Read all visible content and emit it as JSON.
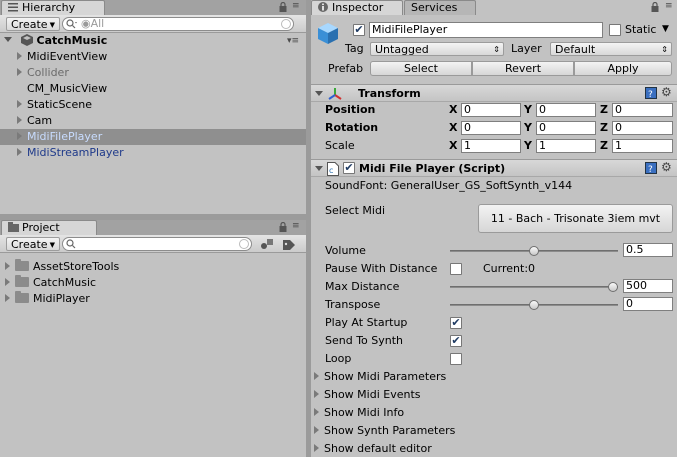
{
  "hierarchy": {
    "tab_label": "Hierarchy",
    "create_label": "Create",
    "search_placeholder": "◉All",
    "scene_name": "CatchMusic",
    "items": [
      {
        "label": "MidiEventView",
        "expandable": true,
        "state": "normal"
      },
      {
        "label": "Collider",
        "expandable": true,
        "state": "disabled"
      },
      {
        "label": "CM_MusicView",
        "expandable": false,
        "state": "normal"
      },
      {
        "label": "StaticScene",
        "expandable": true,
        "state": "normal"
      },
      {
        "label": "Cam",
        "expandable": true,
        "state": "normal"
      },
      {
        "label": "MidiFilePlayer",
        "expandable": true,
        "state": "selected"
      },
      {
        "label": "MidiStreamPlayer",
        "expandable": true,
        "state": "prefab"
      }
    ]
  },
  "project": {
    "tab_label": "Project",
    "create_label": "Create",
    "folders": [
      "AssetStoreTools",
      "CatchMusic",
      "MidiPlayer"
    ]
  },
  "inspector": {
    "tab_label": "Inspector",
    "services_tab_label": "Services",
    "object_name": "MidiFilePlayer",
    "static_label": "Static",
    "tag_label": "Tag",
    "tag_value": "Untagged",
    "layer_label": "Layer",
    "layer_value": "Default",
    "prefab_label": "Prefab",
    "prefab_buttons": [
      "Select",
      "Revert",
      "Apply"
    ],
    "transform": {
      "title": "Transform",
      "rows": [
        {
          "label": "Position",
          "bold": true,
          "x": "0",
          "y": "0",
          "z": "0"
        },
        {
          "label": "Rotation",
          "bold": true,
          "x": "0",
          "y": "0",
          "z": "0"
        },
        {
          "label": "Scale",
          "bold": false,
          "x": "1",
          "y": "1",
          "z": "1"
        }
      ],
      "axis_labels": [
        "X",
        "Y",
        "Z"
      ]
    },
    "script": {
      "title": "Midi File Player (Script)",
      "soundfont_text": "SoundFont: GeneralUser_GS_SoftSynth_v144",
      "select_midi_label": "Select Midi",
      "select_midi_value": "11 - Bach - Trisonate 3iem mvt",
      "volume_label": "Volume",
      "volume_value": "0.5",
      "volume_fraction": 0.5,
      "pause_label": "Pause With Distance",
      "pause_checked": false,
      "current_label": "Current:0",
      "max_distance_label": "Max Distance",
      "max_distance_value": "500",
      "max_distance_fraction": 1.0,
      "transpose_label": "Transpose",
      "transpose_value": "0",
      "transpose_fraction": 0.5,
      "play_at_startup_label": "Play At Startup",
      "play_at_startup_checked": true,
      "send_to_synth_label": "Send To Synth",
      "send_to_synth_checked": true,
      "loop_label": "Loop",
      "loop_checked": false,
      "foldouts": [
        "Show Midi Parameters",
        "Show Midi Events",
        "Show Midi Info",
        "Show Synth Parameters",
        "Show default editor"
      ]
    }
  },
  "colors": {
    "selection": "#8f8f8f",
    "selected_text": "#c8dcff",
    "prefab_text": "#1f3a8a",
    "disabled_text": "#6b6b6b",
    "panel": "#c2c2c2"
  }
}
